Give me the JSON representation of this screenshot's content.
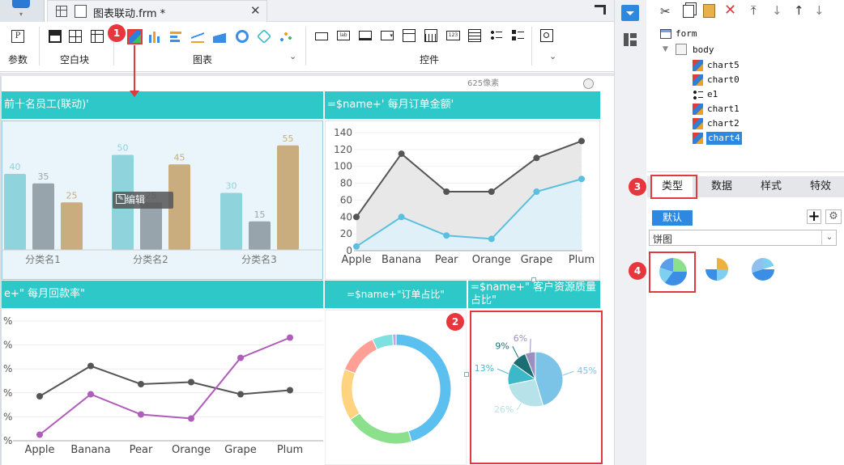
{
  "editor_tab": {
    "title": "图表联动.frm *"
  },
  "toolbar": {
    "groups": [
      {
        "label": "参数"
      },
      {
        "label": "空白块"
      },
      {
        "label": "图表"
      },
      {
        "label": "控件"
      }
    ]
  },
  "canvas": {
    "width_hint": "625像素",
    "edit_label": "编辑",
    "panels": [
      {
        "title": "前十名员工(联动)'"
      },
      {
        "title": "=$name+' 每月订单金额'"
      },
      {
        "title": "e+\" 每月回款率\""
      },
      {
        "title": "=$name+\"订单占比\""
      },
      {
        "title": "=$name+\" 客户资源质量占比\""
      }
    ]
  },
  "tree": {
    "items": [
      "form",
      "body",
      "chart5",
      "chart0",
      "e1",
      "chart1",
      "chart2",
      "chart4"
    ],
    "selected": "chart4"
  },
  "properties": {
    "tabs": [
      "类型",
      "数据",
      "样式",
      "特效"
    ],
    "active_tab": "类型",
    "default_btn": "默认",
    "chart_type_select": "饼图"
  },
  "badges": [
    "1",
    "2",
    "3",
    "4"
  ],
  "chart_data": [
    {
      "type": "bar",
      "categories": [
        "分类名1",
        "分类名2",
        "分类名3"
      ],
      "series": [
        {
          "values": [
            40,
            50,
            30
          ]
        },
        {
          "values": [
            35,
            25,
            15
          ]
        },
        {
          "values": [
            25,
            45,
            55
          ]
        }
      ],
      "colors": [
        "#8fd3dc",
        "#98a4ac",
        "#c9ad7f"
      ]
    },
    {
      "type": "area",
      "categories": [
        "Apple",
        "Banana",
        "Pear",
        "Orange",
        "Grape",
        "Plum"
      ],
      "yticks": [
        "0",
        "20",
        "40",
        "60",
        "80",
        "100",
        "120",
        "140"
      ],
      "ylim": [
        0,
        140
      ],
      "series": [
        {
          "values": [
            40,
            115,
            70,
            70,
            110,
            130
          ],
          "color": "#555555"
        },
        {
          "values": [
            5,
            40,
            18,
            14,
            70,
            85
          ],
          "color": "#5bc0e0"
        }
      ]
    },
    {
      "type": "line",
      "categories": [
        "Apple",
        "Banana",
        "Pear",
        "Orange",
        "Grape",
        "Plum"
      ],
      "yticks": [
        "%",
        "%",
        "%",
        "%",
        "%",
        "%"
      ],
      "series": [
        {
          "values": [
            2.2,
            3.7,
            2.8,
            2.9,
            2.3,
            2.5
          ],
          "color": "#555555"
        },
        {
          "values": [
            0.3,
            2.3,
            1.3,
            1.1,
            4.1,
            5.1
          ],
          "color": "#b05cba"
        }
      ]
    },
    {
      "type": "pie",
      "donut": true,
      "values": [
        45,
        20,
        15,
        12,
        6,
        1
      ],
      "colors": [
        "#5bc0f0",
        "#8be08b",
        "#ffd37f",
        "#ff9f96",
        "#7fe0e0",
        "#c3a8e0"
      ]
    },
    {
      "type": "pie",
      "labels": [
        "45%",
        "26%",
        "13%",
        "9%",
        "6%"
      ],
      "values": [
        45,
        26,
        13,
        9,
        6
      ],
      "colors": [
        "#7cc3e8",
        "#b7e2ea",
        "#3cb8c8",
        "#1a6e74",
        "#9b8fc0"
      ]
    }
  ]
}
